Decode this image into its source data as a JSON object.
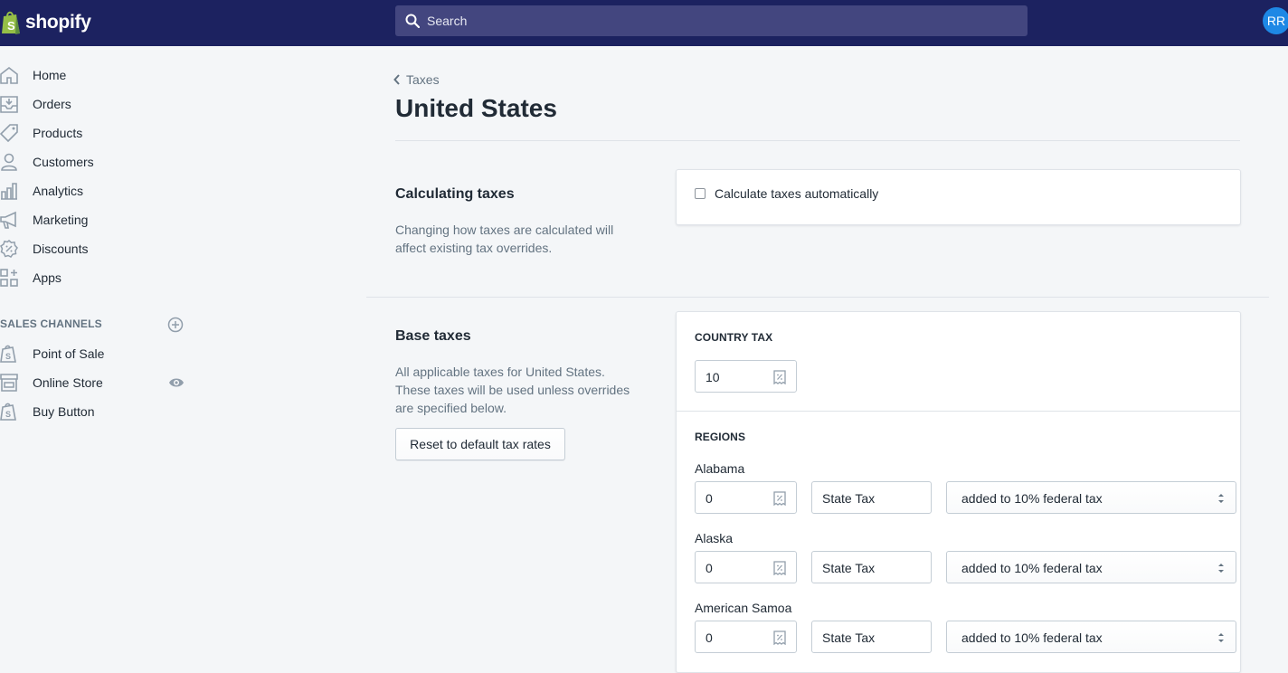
{
  "topbar": {
    "brand": "shopify",
    "search_placeholder": "Search",
    "avatar_initials": "RR",
    "colors": {
      "background": "#1c2260",
      "search_bg": "#43467f",
      "avatar_bg": "#1e88e5",
      "logo_bag": "#95bf47"
    }
  },
  "sidebar": {
    "items": [
      {
        "label": "Home",
        "icon": "home-icon"
      },
      {
        "label": "Orders",
        "icon": "orders-icon"
      },
      {
        "label": "Products",
        "icon": "tag-icon"
      },
      {
        "label": "Customers",
        "icon": "person-icon"
      },
      {
        "label": "Analytics",
        "icon": "bar-chart-icon"
      },
      {
        "label": "Marketing",
        "icon": "megaphone-icon"
      },
      {
        "label": "Discounts",
        "icon": "discount-icon"
      },
      {
        "label": "Apps",
        "icon": "apps-icon"
      }
    ],
    "sales_channels_title": "SALES CHANNELS",
    "channels": [
      {
        "label": "Point of Sale",
        "icon": "shopify-bag-icon"
      },
      {
        "label": "Online Store",
        "icon": "store-icon"
      },
      {
        "label": "Buy Button",
        "icon": "shopify-bag-icon"
      }
    ]
  },
  "main": {
    "breadcrumb": "Taxes",
    "title": "United States",
    "calculating": {
      "heading": "Calculating taxes",
      "description": "Changing how taxes are calculated will affect existing tax overrides.",
      "checkbox_label": "Calculate taxes automatically",
      "checked": false
    },
    "base": {
      "heading": "Base taxes",
      "description": "All applicable taxes for United States. These taxes will be used unless overrides are specified below.",
      "reset_button": "Reset to default tax rates",
      "country_tax_label": "COUNTRY TAX",
      "country_tax_value": "10",
      "regions_label": "REGIONS",
      "regions": [
        {
          "name": "Alabama",
          "rate": "0",
          "tax_name": "State Tax",
          "mode": "added to 10% federal tax"
        },
        {
          "name": "Alaska",
          "rate": "0",
          "tax_name": "State Tax",
          "mode": "added to 10% federal tax"
        },
        {
          "name": "American Samoa",
          "rate": "0",
          "tax_name": "State Tax",
          "mode": "added to 10% federal tax"
        }
      ]
    }
  }
}
